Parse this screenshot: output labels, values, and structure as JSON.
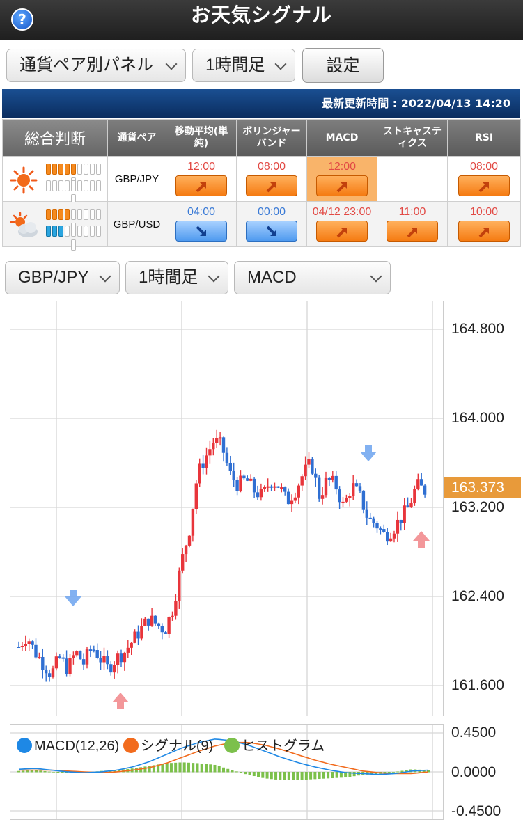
{
  "header": {
    "title": "お天気シグナル",
    "help_icon": "?"
  },
  "controls": {
    "panel_select": "通貨ペア別パネル",
    "timeframe_select": "1時間足",
    "settings_label": "設定"
  },
  "update": {
    "text": "最新更新時間 : 2022/04/13 14:20"
  },
  "table": {
    "headers": [
      "総合判断",
      "通貨ペア",
      "移動平均(単純)",
      "ボリンジャーバンド",
      "MACD",
      "ストキャスティクス",
      "RSI"
    ],
    "rows": [
      {
        "pair": "GBP/JPY",
        "weather": "sunny",
        "levels": {
          "orange": 5,
          "blue": 0,
          "total": 10
        },
        "cells": [
          {
            "time": "12:00",
            "dir": "up"
          },
          {
            "time": "08:00",
            "dir": "up"
          },
          {
            "time": "12:00",
            "dir": "up",
            "highlight": true
          },
          null,
          {
            "time": "08:00",
            "dir": "up"
          }
        ]
      },
      {
        "pair": "GBP/USD",
        "weather": "partly-cloudy",
        "levels": {
          "orange": 4,
          "blue": 3,
          "total": 10
        },
        "cells": [
          {
            "time": "04:00",
            "dir": "down"
          },
          {
            "time": "00:00",
            "dir": "down"
          },
          {
            "time": "04/12 23:00",
            "dir": "up"
          },
          {
            "time": "11:00",
            "dir": "up"
          },
          {
            "time": "10:00",
            "dir": "up"
          }
        ]
      }
    ]
  },
  "chart_controls": {
    "pair_select": "GBP/JPY",
    "timeframe_select": "1時間足",
    "indicator_select": "MACD"
  },
  "colors": {
    "up": "#e8353b",
    "down": "#2f6fd2",
    "macd": "#1e88e5",
    "signal": "#f26b1d",
    "histogram": "#7cc04b",
    "price_tag": "#e89a3a"
  },
  "chart_data": [
    {
      "type": "candlestick",
      "y_ticks": [
        "164.800",
        "164.000",
        "163.200",
        "162.400",
        "161.600"
      ],
      "ylim": [
        161.6,
        164.8
      ],
      "current_price": "163.373",
      "close_path": [
        161.95,
        162.05,
        161.9,
        161.8,
        161.7,
        161.85,
        161.75,
        161.9,
        161.8,
        161.95,
        161.85,
        161.75,
        161.85,
        161.9,
        162.0,
        162.1,
        162.2,
        162.15,
        162.1,
        162.3,
        162.7,
        163.0,
        163.5,
        163.65,
        163.8,
        163.75,
        163.5,
        163.4,
        163.45,
        163.35,
        163.3,
        163.45,
        163.4,
        163.25,
        163.35,
        163.5,
        163.6,
        163.3,
        163.45,
        163.4,
        163.2,
        163.4,
        163.3,
        163.1,
        163.05,
        162.95,
        163.0,
        163.1,
        163.2,
        163.4,
        163.35
      ],
      "signal_arrows": [
        {
          "dir": "down",
          "price": 162.35
        },
        {
          "dir": "up",
          "price": 161.5
        },
        {
          "dir": "down",
          "price": 163.65
        },
        {
          "dir": "up",
          "price": 162.95
        }
      ]
    },
    {
      "type": "line",
      "y_ticks": [
        "0.4500",
        "0.0000",
        "-0.4500"
      ],
      "ylim": [
        -0.45,
        0.45
      ],
      "series": [
        {
          "name": "MACD(12,26)",
          "values": [
            0.03,
            0.04,
            0.02,
            0.0,
            -0.01,
            0.0,
            0.02,
            0.06,
            0.12,
            0.2,
            0.28,
            0.34,
            0.38,
            0.36,
            0.31,
            0.24,
            0.17,
            0.11,
            0.06,
            0.02,
            -0.01,
            -0.02,
            -0.03,
            -0.02,
            0.01,
            0.02
          ]
        },
        {
          "name": "シグナル(9)",
          "values": [
            0.02,
            0.02,
            0.02,
            0.01,
            0.0,
            -0.01,
            0.0,
            0.02,
            0.05,
            0.1,
            0.17,
            0.24,
            0.3,
            0.34,
            0.34,
            0.31,
            0.26,
            0.2,
            0.14,
            0.09,
            0.05,
            0.01,
            -0.01,
            -0.02,
            -0.02,
            0.0
          ]
        },
        {
          "name": "ヒストグラム",
          "values": [
            0.01,
            0.02,
            0.0,
            -0.01,
            -0.01,
            0.01,
            0.02,
            0.04,
            0.07,
            0.1,
            0.11,
            0.1,
            0.08,
            0.02,
            -0.03,
            -0.07,
            -0.09,
            -0.09,
            -0.08,
            -0.07,
            -0.06,
            -0.03,
            -0.02,
            0.0,
            0.03,
            0.02
          ]
        }
      ]
    }
  ]
}
